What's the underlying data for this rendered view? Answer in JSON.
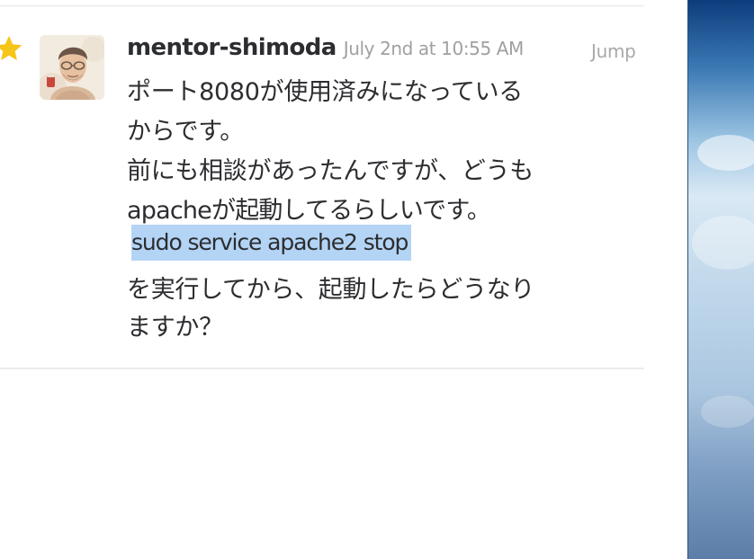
{
  "message": {
    "username": "mentor-shimoda",
    "timestamp": "July 2nd at 10:55 AM",
    "jump_label": "Jump",
    "lines": [
      "ポート8080が使用済みになっている",
      "からです。",
      "前にも相談があったんですが、どうも",
      "apacheが起動してるらしいです。",
      "を実行してから、起動したらどうなり",
      "ますか？"
    ],
    "highlighted_code": "sudo service apache2 stop"
  },
  "icons": {
    "star": "star-icon",
    "avatar": "avatar"
  },
  "colors": {
    "star": "#f5c518",
    "highlight": "#b3d4f5",
    "username": "#2c2d30",
    "timestamp": "#a0a0a2",
    "text": "#2c2d30"
  }
}
